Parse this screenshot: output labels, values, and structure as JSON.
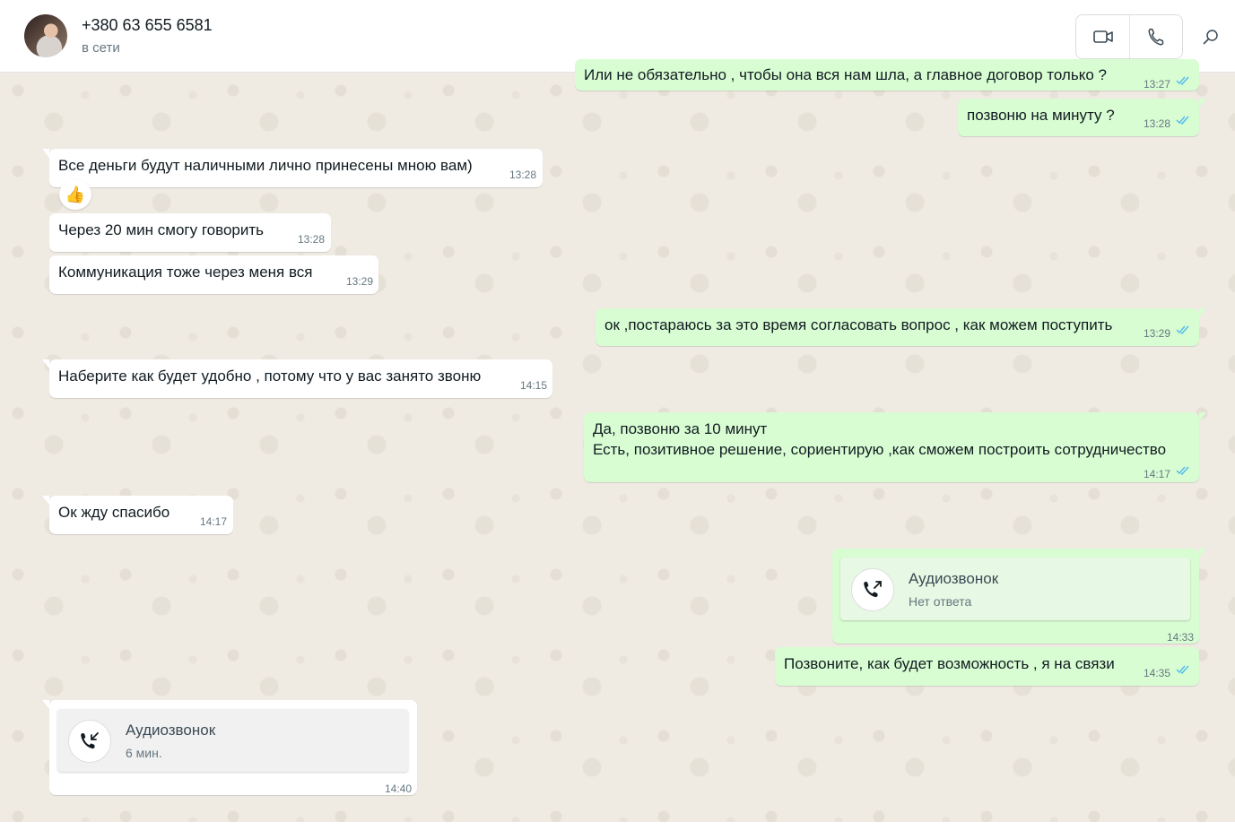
{
  "header": {
    "contact_name": "+380 63 655 6581",
    "status": "в сети",
    "icons": [
      "video-call-icon",
      "phone-call-icon",
      "search-icon"
    ]
  },
  "colors": {
    "outgoing_bubble": "#d9fdd3",
    "incoming_bubble": "#ffffff",
    "chat_background": "#efeae2",
    "read_ticks": "#53bdeb"
  },
  "messages": [
    {
      "dir": "out",
      "text": "Или не обязательно , чтобы она вся нам шла, а главное договор только ?",
      "time": "13:27",
      "read": true
    },
    {
      "dir": "out",
      "text": "позвоню на минуту ?",
      "time": "13:28",
      "read": true
    },
    {
      "dir": "in",
      "text": "Все деньги будут наличными лично принесены мною вам)",
      "time": "13:28",
      "reaction": "👍"
    },
    {
      "dir": "in",
      "text": "Через 20 мин смогу говорить",
      "time": "13:28"
    },
    {
      "dir": "in",
      "text": "Коммуникация тоже через меня вся",
      "time": "13:29"
    },
    {
      "dir": "out",
      "text": "ок ,постараюсь за это время согласовать вопрос , как можем поступить",
      "time": "13:29",
      "read": true
    },
    {
      "dir": "in",
      "text": "Наберите как будет  удобно , потому что у вас занято звоню",
      "time": "14:15"
    },
    {
      "dir": "out",
      "text_line1": "Да, позвоню за 10 минут",
      "text_line2": "Есть, позитивное решение, сориентирую ,как сможем построить сотрудничество",
      "time": "14:17",
      "read": true
    },
    {
      "dir": "in",
      "text": "Ок жду спасибо",
      "time": "14:17"
    },
    {
      "dir": "out",
      "type": "call",
      "call_title": "Аудиозвонок",
      "call_status": "Нет ответа",
      "time": "14:33"
    },
    {
      "dir": "out",
      "text": "Позвоните, как будет возможность , я на связи",
      "time": "14:35",
      "read": true
    },
    {
      "dir": "in",
      "type": "call",
      "call_title": "Аудиозвонок",
      "call_status": "6 мин.",
      "time": "14:40"
    }
  ]
}
